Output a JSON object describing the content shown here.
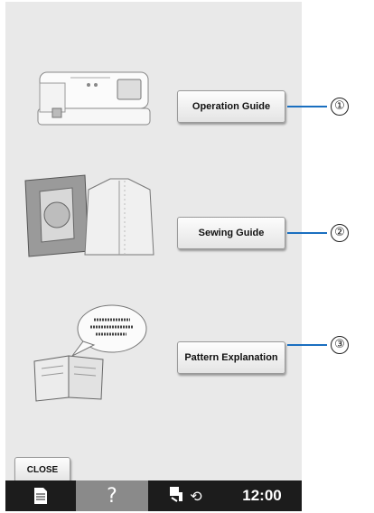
{
  "guide_items": [
    {
      "label": "Operation Guide",
      "number": "①",
      "illustration": "sewing-machine"
    },
    {
      "label": "Sewing Guide",
      "number": "②",
      "illustration": "quilt-and-shirt"
    },
    {
      "label": "Pattern Explanation",
      "number": "③",
      "illustration": "book-with-speech-bubble"
    }
  ],
  "close_label": "CLOSE",
  "status_bar": {
    "time": "12:00",
    "icons": [
      "document-icon",
      "help-icon",
      "presser-foot-icon",
      "rotate-icon"
    ]
  },
  "colors": {
    "callout": "#1a6fc0",
    "status_bar_bg": "#1c1c1c",
    "screen_bg": "#e9e9e9"
  }
}
